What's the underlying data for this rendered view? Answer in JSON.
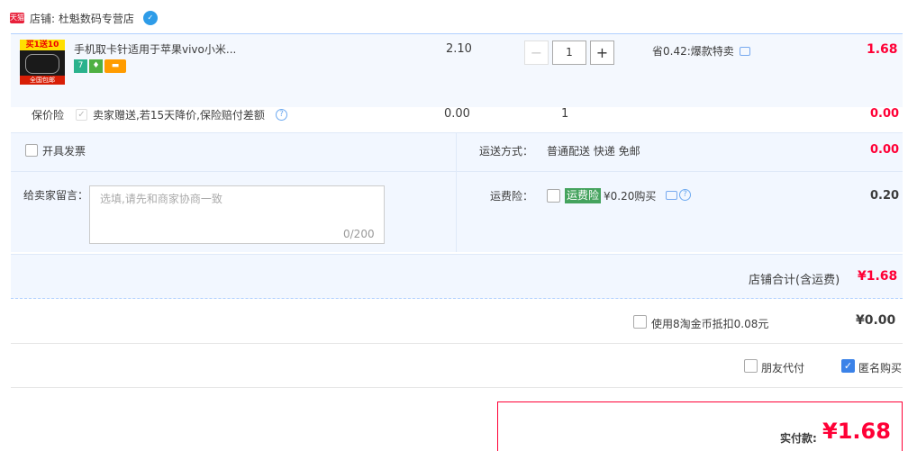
{
  "shop": {
    "badge": "天猫",
    "name": "店铺: 杜魁数码专营店"
  },
  "item": {
    "thumb_top": "买1送10",
    "thumb_bottom": "全国包邮",
    "title": "手机取卡针适用于苹果vivo小米...",
    "service_icons": [
      "seven-day-return-icon",
      "guarantee-icon",
      "credit-card-icon"
    ],
    "unit_price": "2.10",
    "quantity": "1",
    "minus": "−",
    "plus": "+",
    "promo": "省0.42:爆款特卖",
    "total": "1.68"
  },
  "insurance": {
    "label": "保价险",
    "description": "卖家赠送,若15天降价,保险赔付差额",
    "help": "?",
    "price": "0.00",
    "quantity": "1",
    "total": "0.00"
  },
  "invoice": {
    "label": "开具发票"
  },
  "shipping": {
    "label": "运送方式：",
    "value": "普通配送 快递 免邮",
    "price": "0.00"
  },
  "message": {
    "label": "给卖家留言：",
    "placeholder": "选填,请先和商家协商一致",
    "count": "0/200"
  },
  "freight_insurance": {
    "label": "运费险：",
    "tag": "运费险",
    "buy_text": "¥0.20购买",
    "help": "?",
    "price": "0.20"
  },
  "shop_total": {
    "label": "店铺合计(含运费)",
    "value": "¥1.68"
  },
  "coins": {
    "label": "使用8淘金币抵扣0.08元",
    "value": "¥0.00"
  },
  "friend_pay": {
    "label": "朋友代付",
    "checked": false
  },
  "anonymous": {
    "label": "匿名购买",
    "checked": true,
    "check_mark": "✓"
  },
  "payment": {
    "label": "实付款:",
    "value": "¥1.68"
  },
  "colors": {
    "accent_red": "#ff0036",
    "blue": "#3b82e8",
    "freight_green": "#45a35e"
  }
}
